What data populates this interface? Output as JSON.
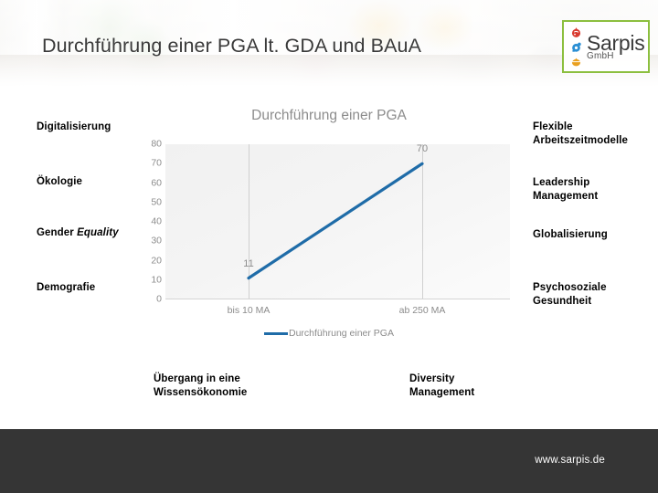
{
  "header": {
    "title": "Durchführung einer PGA lt. GDA und BAuA",
    "background": "office-photo"
  },
  "logo": {
    "name": "Sarpis",
    "suffix": "GmbH",
    "border_color": "#8cbf3f",
    "icons": [
      {
        "name": "red-drop-icon",
        "color": "#d93b30"
      },
      {
        "name": "blue-gear-icon",
        "color": "#2b8fd4"
      },
      {
        "name": "orange-bulb-icon",
        "color": "#e9a020"
      }
    ]
  },
  "satellites": {
    "left": [
      {
        "id": "digitalisierung",
        "label": "Digitalisierung"
      },
      {
        "id": "oekologie",
        "label": "Ökologie"
      },
      {
        "id": "gender",
        "label_plain": "Gender ",
        "label_italic": "Equality"
      },
      {
        "id": "demografie",
        "label": "Demografie"
      }
    ],
    "right": [
      {
        "id": "flexible",
        "line1": "Flexible",
        "line2": "Arbeitszeitmodelle"
      },
      {
        "id": "leadership",
        "line1": "Leadership",
        "line2": "Management"
      },
      {
        "id": "globalisierung",
        "line1": "Globalisierung",
        "line2": ""
      },
      {
        "id": "psychosoziale",
        "line1": "Psychosoziale",
        "line2": "Gesundheit"
      }
    ],
    "bottom": [
      {
        "id": "uebergang",
        "line1": "Übergang in eine",
        "line2": "Wissensökonomie"
      },
      {
        "id": "diversity",
        "line1": "Diversity",
        "line2": "Management"
      }
    ]
  },
  "footer": {
    "url": "www.sarpis.de",
    "background": "#353535"
  },
  "chart_data": {
    "type": "line",
    "title": "Durchführung einer PGA",
    "xlabel": "",
    "ylabel": "",
    "categories": [
      "bis 10 MA",
      "ab 250 MA"
    ],
    "values": [
      11,
      70
    ],
    "point_labels": [
      "11",
      "70"
    ],
    "series": [
      {
        "name": "Durchführung einer PGA",
        "values": [
          11,
          70
        ],
        "color": "#1f6ca8"
      }
    ],
    "ylim": [
      0,
      80
    ],
    "yticks": [
      80,
      70,
      60,
      50,
      40,
      30,
      20,
      10,
      0
    ],
    "grid": "vertical-category-lines",
    "legend": {
      "position": "bottom",
      "entries": [
        "Durchführung einer PGA"
      ]
    },
    "plot_background": "#f3f3f3"
  }
}
